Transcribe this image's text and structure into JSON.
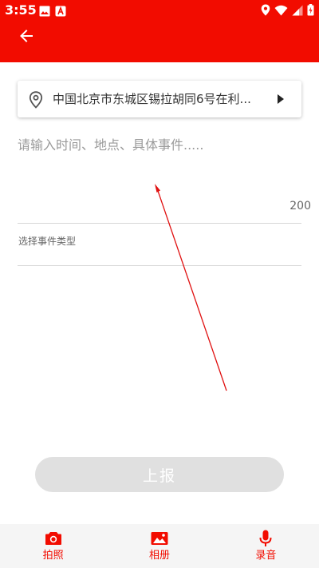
{
  "status_bar": {
    "time": "3:55"
  },
  "location": {
    "address": "中国北京市东城区锡拉胡同6号在利..."
  },
  "description": {
    "placeholder": "请输入时间、地点、具体事件.....",
    "max_chars": "200"
  },
  "event_type": {
    "label": "选择事件类型"
  },
  "submit": {
    "label": "上报"
  },
  "bottom_tabs": [
    {
      "label": "拍照",
      "icon": "camera-icon"
    },
    {
      "label": "相册",
      "icon": "image-icon"
    },
    {
      "label": "录音",
      "icon": "microphone-icon"
    }
  ],
  "colors": {
    "primary": "#f20c00",
    "disabled_button": "#e0e0e0",
    "bottom_bar": "#f5f5f5"
  }
}
